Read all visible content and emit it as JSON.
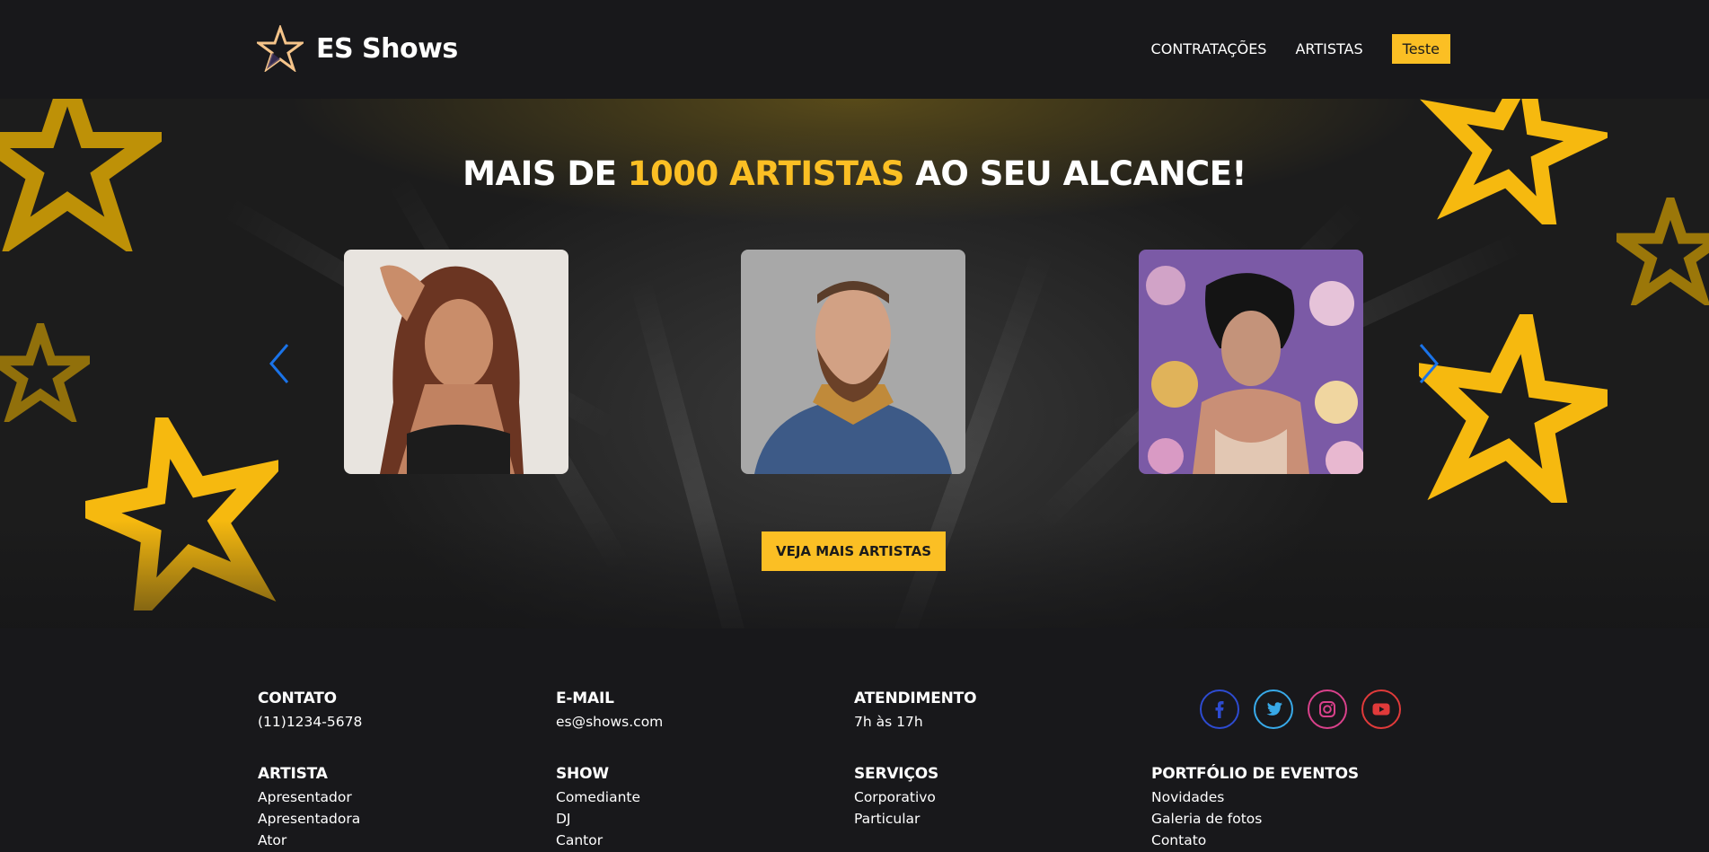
{
  "header": {
    "brand": "ES Shows",
    "nav": [
      "CONTRATAÇÕES",
      "ARTISTAS"
    ],
    "button": "Teste"
  },
  "hero": {
    "title_prefix": "MAIS DE ",
    "title_accent": "1000 ARTISTAS",
    "title_suffix": " AO SEU ALCANCE!",
    "cta": "VEJA MAIS ARTISTAS",
    "accent_color": "#fbbf24",
    "arrow_color": "#1a73e8"
  },
  "footer": {
    "contact": {
      "title": "CONTATO",
      "value": "(11)1234-5678"
    },
    "email": {
      "title": "E-MAIL",
      "value": "es@shows.com"
    },
    "hours": {
      "title": "ATENDIMENTO",
      "value": "7h às 17h"
    },
    "social": [
      "facebook-icon",
      "twitter-icon",
      "instagram-icon",
      "youtube-icon"
    ],
    "artista": {
      "title": "ARTISTA",
      "items": [
        "Apresentador",
        "Apresentadora",
        "Ator"
      ]
    },
    "show": {
      "title": "SHOW",
      "items": [
        "Comediante",
        "DJ",
        "Cantor"
      ]
    },
    "servicos": {
      "title": "SERVIÇOS",
      "items": [
        "Corporativo",
        "Particular"
      ]
    },
    "portfolio": {
      "title": "PORTFÓLIO DE EVENTOS",
      "items": [
        "Novidades",
        "Galeria de fotos",
        "Contato"
      ]
    }
  }
}
